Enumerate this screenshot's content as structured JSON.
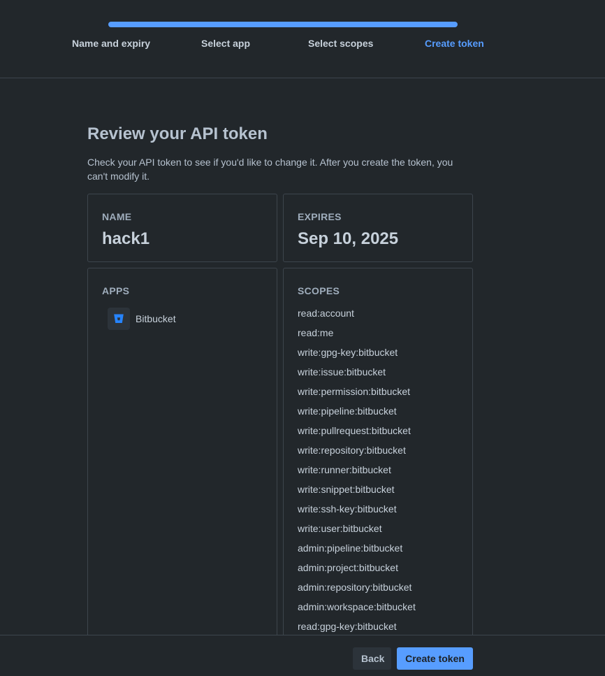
{
  "progress": {
    "steps": [
      {
        "label": "Name and expiry",
        "active": false
      },
      {
        "label": "Select app",
        "active": false
      },
      {
        "label": "Select scopes",
        "active": false
      },
      {
        "label": "Create token",
        "active": true
      }
    ],
    "completion": 1.0
  },
  "review": {
    "title": "Review your API token",
    "description": "Check your API token to see if you'd like to change it. After you create the token, you can't modify it."
  },
  "name_card": {
    "label": "NAME",
    "value": "hack1"
  },
  "expires_card": {
    "label": "EXPIRES",
    "value": "Sep 10, 2025"
  },
  "apps_card": {
    "label": "APPS",
    "apps": [
      {
        "name": "Bitbucket",
        "icon": "bitbucket-logo-icon"
      }
    ]
  },
  "scopes_card": {
    "label": "SCOPES",
    "scopes": [
      "read:account",
      "read:me",
      "write:gpg-key:bitbucket",
      "write:issue:bitbucket",
      "write:permission:bitbucket",
      "write:pipeline:bitbucket",
      "write:pullrequest:bitbucket",
      "write:repository:bitbucket",
      "write:runner:bitbucket",
      "write:snippet:bitbucket",
      "write:ssh-key:bitbucket",
      "write:user:bitbucket",
      "admin:pipeline:bitbucket",
      "admin:project:bitbucket",
      "admin:repository:bitbucket",
      "admin:workspace:bitbucket",
      "read:gpg-key:bitbucket"
    ]
  },
  "footer": {
    "back_label": "Back",
    "create_label": "Create token"
  },
  "colors": {
    "accent": "#579dff",
    "background": "#22272b",
    "border": "#3d454d"
  }
}
